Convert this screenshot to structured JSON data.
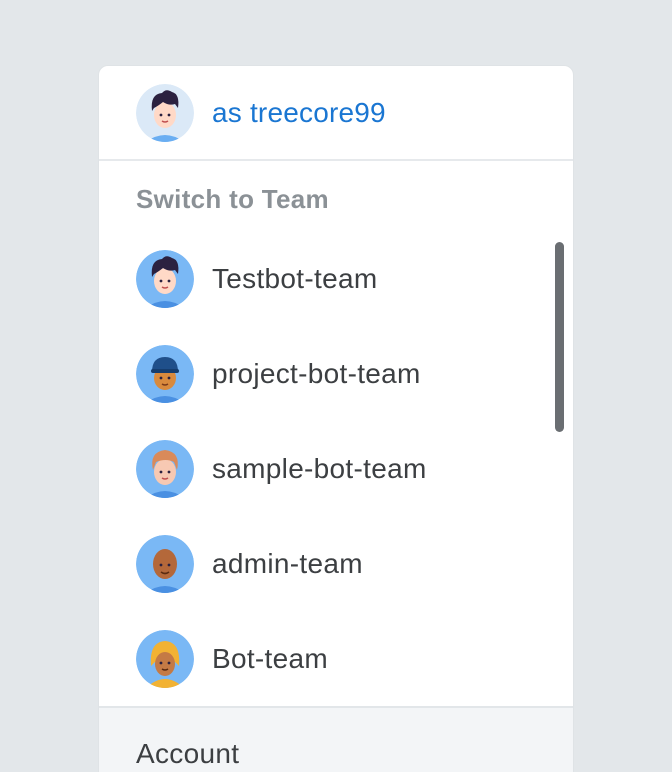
{
  "current_user": {
    "label": "as treecore99",
    "avatar_icon": "user-avatar-dark-hair-icon"
  },
  "switch_section": {
    "title": "Switch to Team"
  },
  "teams": [
    {
      "label": "Testbot-team",
      "avatar_icon": "avatar-dark-hair-icon"
    },
    {
      "label": "project-bot-team",
      "avatar_icon": "avatar-cap-icon"
    },
    {
      "label": "sample-bot-team",
      "avatar_icon": "avatar-ginger-hair-icon"
    },
    {
      "label": "admin-team",
      "avatar_icon": "avatar-bald-icon"
    },
    {
      "label": "Bot-team",
      "avatar_icon": "avatar-yellow-hood-icon"
    }
  ],
  "account": {
    "label": "Account"
  },
  "colors": {
    "accent": "#1a76d2",
    "avatar_background": "#7ab8f5",
    "background": "#e3e7ea",
    "panel": "#ffffff"
  }
}
